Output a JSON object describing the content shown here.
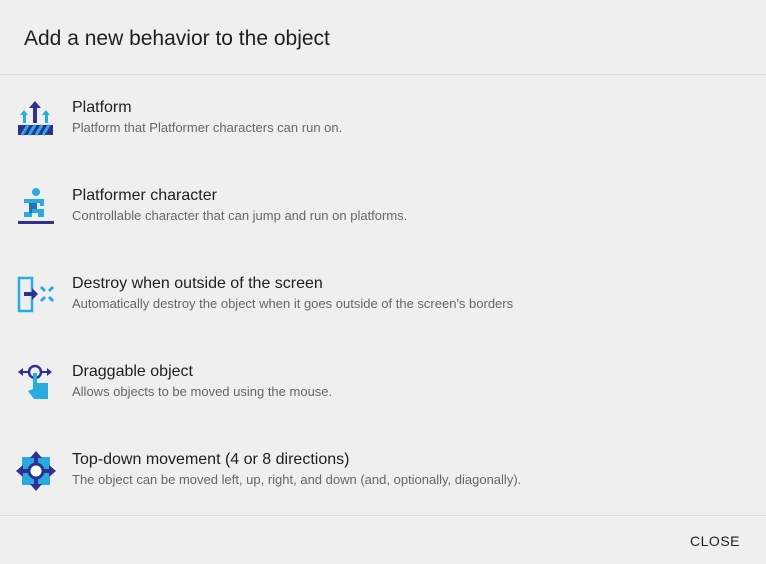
{
  "dialog": {
    "title": "Add a new behavior to the object",
    "close_label": "CLOSE"
  },
  "colors": {
    "dark_blue": "#2e3192",
    "light_blue": "#29abe2"
  },
  "behaviors": [
    {
      "name": "Platform",
      "description": "Platform that Platformer characters can run on.",
      "icon": "platform-icon"
    },
    {
      "name": "Platformer character",
      "description": "Controllable character that can jump and run on platforms.",
      "icon": "platformer-character-icon"
    },
    {
      "name": "Destroy when outside of the screen",
      "description": "Automatically destroy the object when it goes outside of the screen's borders",
      "icon": "destroy-outside-icon"
    },
    {
      "name": "Draggable object",
      "description": "Allows objects to be moved using the mouse.",
      "icon": "draggable-icon"
    },
    {
      "name": "Top-down movement (4 or 8 directions)",
      "description": "The object can be moved left, up, right, and down (and, optionally, diagonally).",
      "icon": "topdown-movement-icon"
    }
  ]
}
